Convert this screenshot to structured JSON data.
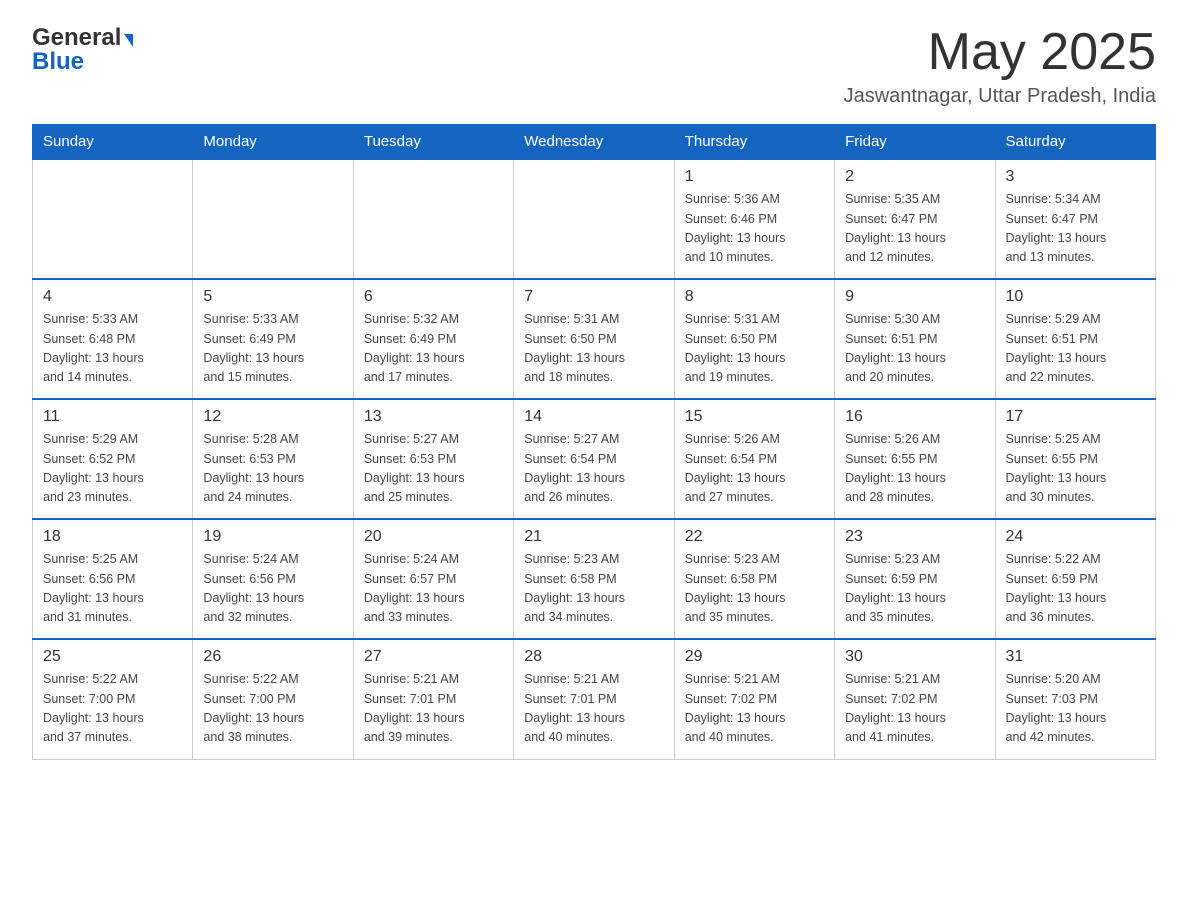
{
  "header": {
    "logo_general": "General",
    "logo_blue": "Blue",
    "month_year": "May 2025",
    "location": "Jaswantnagar, Uttar Pradesh, India"
  },
  "days_of_week": [
    "Sunday",
    "Monday",
    "Tuesday",
    "Wednesday",
    "Thursday",
    "Friday",
    "Saturday"
  ],
  "weeks": [
    [
      {
        "day": "",
        "info": ""
      },
      {
        "day": "",
        "info": ""
      },
      {
        "day": "",
        "info": ""
      },
      {
        "day": "",
        "info": ""
      },
      {
        "day": "1",
        "info": "Sunrise: 5:36 AM\nSunset: 6:46 PM\nDaylight: 13 hours\nand 10 minutes."
      },
      {
        "day": "2",
        "info": "Sunrise: 5:35 AM\nSunset: 6:47 PM\nDaylight: 13 hours\nand 12 minutes."
      },
      {
        "day": "3",
        "info": "Sunrise: 5:34 AM\nSunset: 6:47 PM\nDaylight: 13 hours\nand 13 minutes."
      }
    ],
    [
      {
        "day": "4",
        "info": "Sunrise: 5:33 AM\nSunset: 6:48 PM\nDaylight: 13 hours\nand 14 minutes."
      },
      {
        "day": "5",
        "info": "Sunrise: 5:33 AM\nSunset: 6:49 PM\nDaylight: 13 hours\nand 15 minutes."
      },
      {
        "day": "6",
        "info": "Sunrise: 5:32 AM\nSunset: 6:49 PM\nDaylight: 13 hours\nand 17 minutes."
      },
      {
        "day": "7",
        "info": "Sunrise: 5:31 AM\nSunset: 6:50 PM\nDaylight: 13 hours\nand 18 minutes."
      },
      {
        "day": "8",
        "info": "Sunrise: 5:31 AM\nSunset: 6:50 PM\nDaylight: 13 hours\nand 19 minutes."
      },
      {
        "day": "9",
        "info": "Sunrise: 5:30 AM\nSunset: 6:51 PM\nDaylight: 13 hours\nand 20 minutes."
      },
      {
        "day": "10",
        "info": "Sunrise: 5:29 AM\nSunset: 6:51 PM\nDaylight: 13 hours\nand 22 minutes."
      }
    ],
    [
      {
        "day": "11",
        "info": "Sunrise: 5:29 AM\nSunset: 6:52 PM\nDaylight: 13 hours\nand 23 minutes."
      },
      {
        "day": "12",
        "info": "Sunrise: 5:28 AM\nSunset: 6:53 PM\nDaylight: 13 hours\nand 24 minutes."
      },
      {
        "day": "13",
        "info": "Sunrise: 5:27 AM\nSunset: 6:53 PM\nDaylight: 13 hours\nand 25 minutes."
      },
      {
        "day": "14",
        "info": "Sunrise: 5:27 AM\nSunset: 6:54 PM\nDaylight: 13 hours\nand 26 minutes."
      },
      {
        "day": "15",
        "info": "Sunrise: 5:26 AM\nSunset: 6:54 PM\nDaylight: 13 hours\nand 27 minutes."
      },
      {
        "day": "16",
        "info": "Sunrise: 5:26 AM\nSunset: 6:55 PM\nDaylight: 13 hours\nand 28 minutes."
      },
      {
        "day": "17",
        "info": "Sunrise: 5:25 AM\nSunset: 6:55 PM\nDaylight: 13 hours\nand 30 minutes."
      }
    ],
    [
      {
        "day": "18",
        "info": "Sunrise: 5:25 AM\nSunset: 6:56 PM\nDaylight: 13 hours\nand 31 minutes."
      },
      {
        "day": "19",
        "info": "Sunrise: 5:24 AM\nSunset: 6:56 PM\nDaylight: 13 hours\nand 32 minutes."
      },
      {
        "day": "20",
        "info": "Sunrise: 5:24 AM\nSunset: 6:57 PM\nDaylight: 13 hours\nand 33 minutes."
      },
      {
        "day": "21",
        "info": "Sunrise: 5:23 AM\nSunset: 6:58 PM\nDaylight: 13 hours\nand 34 minutes."
      },
      {
        "day": "22",
        "info": "Sunrise: 5:23 AM\nSunset: 6:58 PM\nDaylight: 13 hours\nand 35 minutes."
      },
      {
        "day": "23",
        "info": "Sunrise: 5:23 AM\nSunset: 6:59 PM\nDaylight: 13 hours\nand 35 minutes."
      },
      {
        "day": "24",
        "info": "Sunrise: 5:22 AM\nSunset: 6:59 PM\nDaylight: 13 hours\nand 36 minutes."
      }
    ],
    [
      {
        "day": "25",
        "info": "Sunrise: 5:22 AM\nSunset: 7:00 PM\nDaylight: 13 hours\nand 37 minutes."
      },
      {
        "day": "26",
        "info": "Sunrise: 5:22 AM\nSunset: 7:00 PM\nDaylight: 13 hours\nand 38 minutes."
      },
      {
        "day": "27",
        "info": "Sunrise: 5:21 AM\nSunset: 7:01 PM\nDaylight: 13 hours\nand 39 minutes."
      },
      {
        "day": "28",
        "info": "Sunrise: 5:21 AM\nSunset: 7:01 PM\nDaylight: 13 hours\nand 40 minutes."
      },
      {
        "day": "29",
        "info": "Sunrise: 5:21 AM\nSunset: 7:02 PM\nDaylight: 13 hours\nand 40 minutes."
      },
      {
        "day": "30",
        "info": "Sunrise: 5:21 AM\nSunset: 7:02 PM\nDaylight: 13 hours\nand 41 minutes."
      },
      {
        "day": "31",
        "info": "Sunrise: 5:20 AM\nSunset: 7:03 PM\nDaylight: 13 hours\nand 42 minutes."
      }
    ]
  ]
}
